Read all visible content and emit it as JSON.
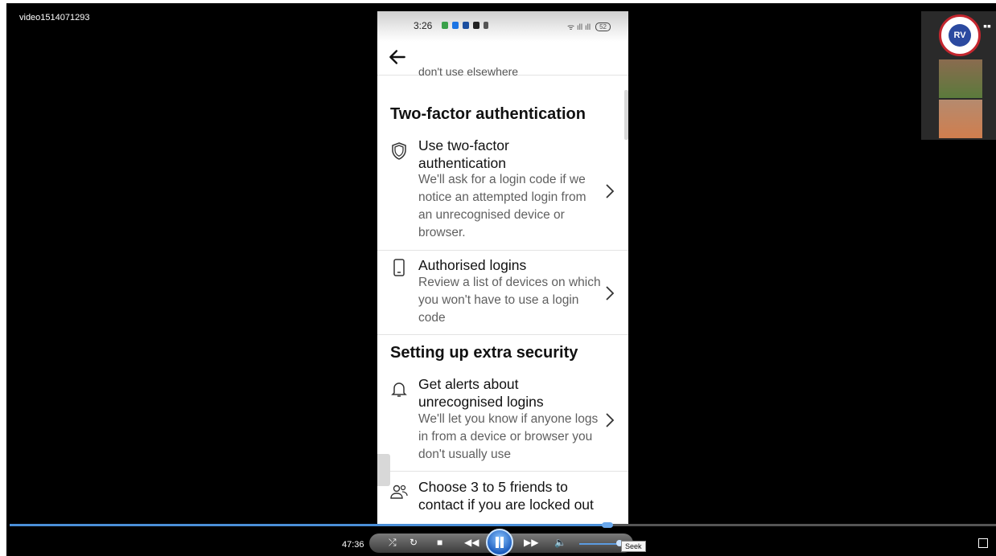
{
  "window": {
    "video_title": "video1514071293"
  },
  "phone": {
    "status_time": "3:26",
    "battery": "52",
    "cut_text": "don't use elsewhere",
    "sections": [
      {
        "title": "Two-factor authentication",
        "items": [
          {
            "icon": "shield-icon",
            "title": "Use two-factor authentication",
            "description": "We'll ask for a login code if we notice an attempted login from an unrecognised device or browser."
          },
          {
            "icon": "phone-icon",
            "title": "Authorised logins",
            "description": "Review a list of devices on which you won't have to use a login code"
          }
        ]
      },
      {
        "title": "Setting up extra security",
        "items": [
          {
            "icon": "bell-icon",
            "title": "Get alerts about unrecognised logins",
            "description": "We'll let you know if anyone logs in from a device or browser you don't usually use"
          },
          {
            "icon": "friends-icon",
            "title": "Choose 3 to 5 friends to contact if you are locked out"
          }
        ]
      }
    ]
  },
  "player": {
    "elapsed": "47:36",
    "seek_tooltip": "Seek",
    "progress_fraction": 0.61,
    "accent": "#4a8fd8"
  },
  "webcam": {
    "logo_text": "RV"
  }
}
